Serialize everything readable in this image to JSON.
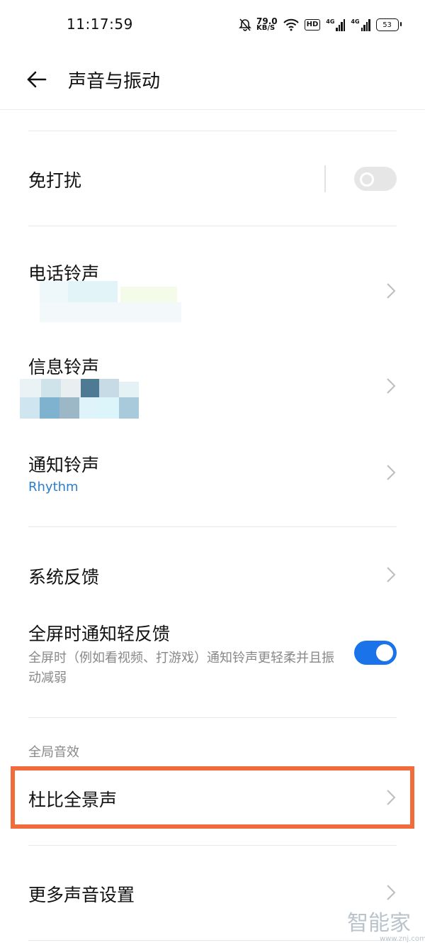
{
  "status": {
    "time": "11:17:59",
    "speed_value": "79.0",
    "speed_unit": "KB/S",
    "hd": "HD",
    "net1": "4G",
    "net2": "4G",
    "battery": "53"
  },
  "header": {
    "title": "声音与振动"
  },
  "rows": {
    "dnd": {
      "title": "免打扰",
      "toggle": false
    },
    "phone": {
      "title": "电话铃声"
    },
    "message": {
      "title": "信息铃声"
    },
    "notify": {
      "title": "通知铃声",
      "value": "Rhythm"
    },
    "feedback": {
      "title": "系统反馈"
    },
    "fullscreen": {
      "title": "全屏时通知轻反馈",
      "subtitle": "全屏时（例如看视频、打游戏）通知铃声更轻柔并且振动减弱",
      "toggle": true
    },
    "section": {
      "label": "全局音效"
    },
    "dolby": {
      "title": "杜比全景声"
    },
    "more": {
      "title": "更多声音设置"
    }
  },
  "watermark": {
    "text": "智能家",
    "url": "www.znj.com"
  },
  "colors": {
    "accent": "#1a73e8",
    "value_text": "#2b7ecb",
    "highlight": "#f26b3a"
  }
}
